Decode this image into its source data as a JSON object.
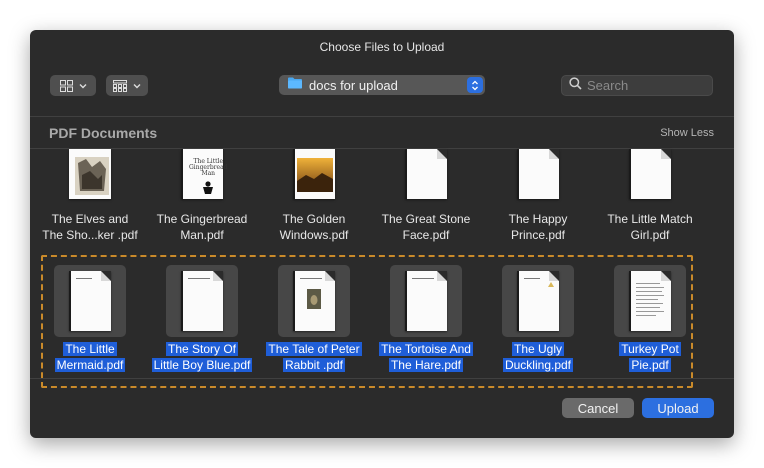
{
  "dialog": {
    "title": "Choose Files to Upload",
    "location": "docs for upload",
    "search_placeholder": "Search",
    "section_title": "PDF Documents",
    "show_less": "Show Less",
    "cancel_label": "Cancel",
    "upload_label": "Upload"
  },
  "toolbar": {
    "view_mode_icon": "icon-grid-view",
    "group_icon": "group-by-grid",
    "chevron_icon": "chevron-down"
  },
  "row1": [
    {
      "line1": "The Elves and",
      "line2": "The Sho...ker .pdf",
      "selected": false,
      "thumb": "illustration"
    },
    {
      "line1": "The Gingerbread",
      "line2": "Man.pdf",
      "selected": false,
      "thumb": "text-cover"
    },
    {
      "line1": "The Golden",
      "line2": "Windows.pdf",
      "selected": false,
      "thumb": "photo"
    },
    {
      "line1": "The Great Stone",
      "line2": "Face.pdf",
      "selected": false,
      "thumb": "blank"
    },
    {
      "line1": "The Happy",
      "line2": "Prince.pdf",
      "selected": false,
      "thumb": "blank"
    },
    {
      "line1": "The Little Match",
      "line2": "Girl.pdf",
      "selected": false,
      "thumb": "blank"
    }
  ],
  "row2": [
    {
      "line1": "The Little",
      "line2": "Mermaid.pdf",
      "selected": true
    },
    {
      "line1": "The Story Of",
      "line2": "Little Boy Blue.pdf",
      "selected": true
    },
    {
      "line1": "The Tale of Peter",
      "line2": "Rabbit .pdf",
      "selected": true
    },
    {
      "line1": "The Tortoise And",
      "line2": "The Hare.pdf",
      "selected": true
    },
    {
      "line1": "The Ugly",
      "line2": "Duckling.pdf",
      "selected": true
    },
    {
      "line1": "Turkey Pot",
      "line2": "Pie.pdf",
      "selected": true
    }
  ],
  "colors": {
    "dialog_bg": "#2b2b2b",
    "accent": "#2c6fe0",
    "selection_text_bg": "#1f5ed8",
    "dashed_outline": "#c98a2a"
  }
}
